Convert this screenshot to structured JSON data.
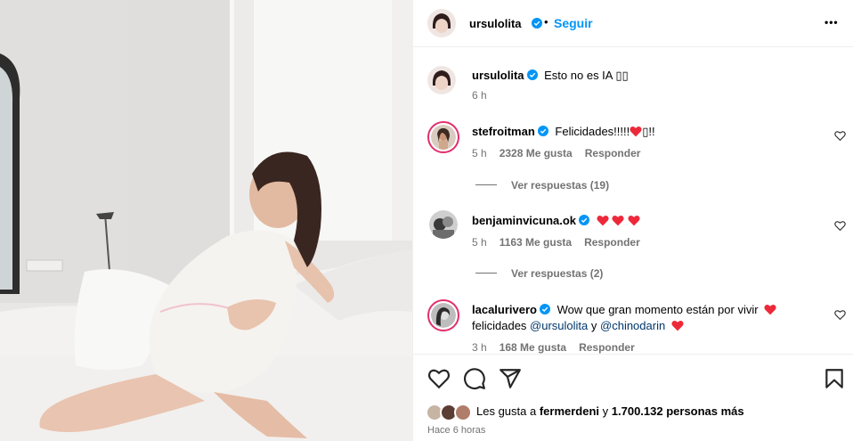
{
  "post": {
    "author": "ursulolita",
    "follow_label": "Seguir",
    "more_label": "•••"
  },
  "caption": {
    "author": "ursulolita",
    "text": "Esto no es IA ▯▯",
    "time": "6 h"
  },
  "comments": [
    {
      "user": "stefroitman",
      "text": "Felicidades!!!!!",
      "text_after": "▯!!",
      "time": "5 h",
      "likes": "2328 Me gusta",
      "reply_label": "Responder",
      "replies": "Ver respuestas (19)"
    },
    {
      "user": "benjaminvicuna.ok",
      "time": "5 h",
      "likes": "1163 Me gusta",
      "reply_label": "Responder",
      "replies": "Ver respuestas (2)"
    },
    {
      "user": "lacalurivero",
      "text": "Wow que gran momento están por vivir",
      "line2_prefix": "felicidades ",
      "mention1": "@ursulolita",
      "and": " y ",
      "mention2": "@chinodarin",
      "time": "3 h",
      "likes": "168 Me gusta",
      "reply_label": "Responder"
    }
  ],
  "footer": {
    "likes_prefix": "Les gusta a ",
    "likes_user": "fermerdeni",
    "likes_mid": " y ",
    "likes_count": "1.700.132 personas más",
    "posted": "Hace 6 horas"
  },
  "colors": {
    "accent": "#0095f6",
    "verified": "#0095f6",
    "heart": "#ed2939",
    "muted": "#737373",
    "mention": "#00376b"
  },
  "icons": [
    "heart-icon",
    "comment-icon",
    "share-icon",
    "bookmark-icon",
    "verified-icon",
    "more-icon"
  ]
}
